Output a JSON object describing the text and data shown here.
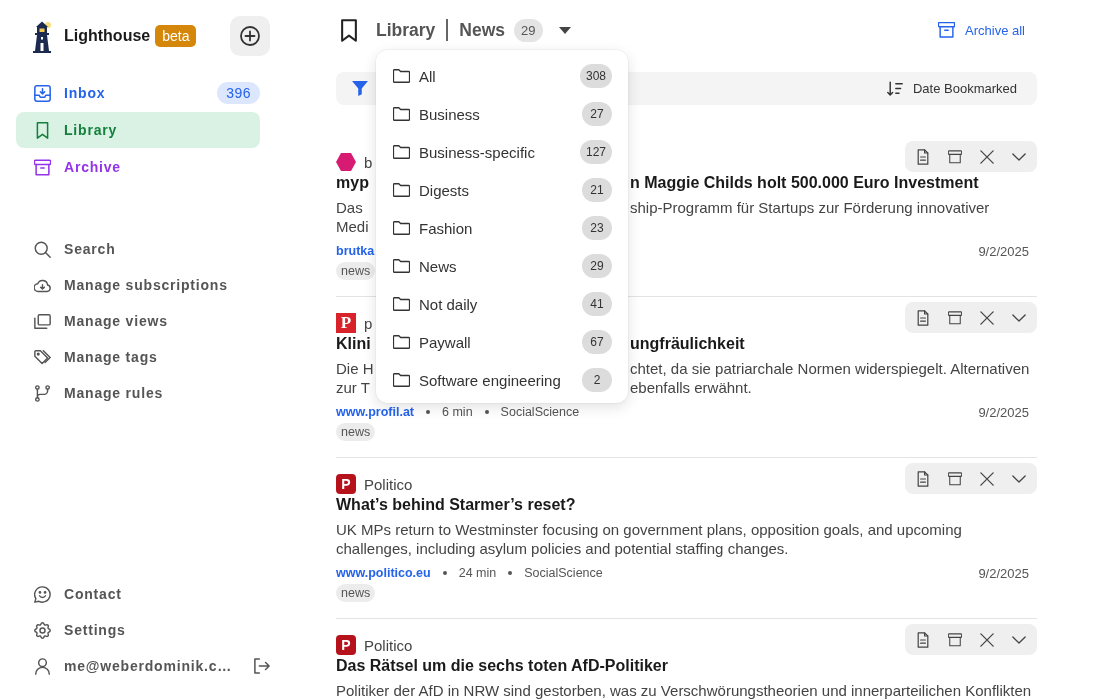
{
  "sidebar": {
    "brand": {
      "name": "Lighthouse",
      "badge": "beta"
    },
    "nav": [
      {
        "label": "Inbox",
        "color": "#2563eb",
        "selected": false,
        "count": "396"
      },
      {
        "label": "Library",
        "color": "#15803d",
        "selected": true
      },
      {
        "label": "Archive",
        "color": "#9333ea",
        "selected": false
      }
    ],
    "tools": [
      {
        "label": "Search"
      },
      {
        "label": "Manage subscriptions"
      },
      {
        "label": "Manage views"
      },
      {
        "label": "Manage tags"
      },
      {
        "label": "Manage rules"
      }
    ],
    "footer": [
      {
        "label": "Contact"
      },
      {
        "label": "Settings"
      }
    ],
    "user": {
      "email": "me@weberdominik.c…"
    }
  },
  "header": {
    "section": "Library",
    "view": "News",
    "count": "29",
    "archive_all": "Archive all"
  },
  "view_menu": [
    {
      "label": "All",
      "count": "308"
    },
    {
      "label": "Business",
      "count": "27"
    },
    {
      "label": "Business-specific",
      "count": "127"
    },
    {
      "label": "Digests",
      "count": "21"
    },
    {
      "label": "Fashion",
      "count": "23"
    },
    {
      "label": "News",
      "count": "29"
    },
    {
      "label": "Not daily",
      "count": "41"
    },
    {
      "label": "Paywall",
      "count": "67"
    },
    {
      "label": "Software engineering",
      "count": "2"
    }
  ],
  "toolbar": {
    "sort": "Date Bookmarked"
  },
  "articles": [
    {
      "logo": {
        "kind": "hexagon",
        "color": "#d81b72"
      },
      "source": "b",
      "title": [
        "myp",
        "n Maggie Childs holt 500.000 Euro Investment"
      ],
      "description": [
        [
          "Das",
          "ship-Programm für Startups zur Förderung innovativer"
        ],
        [
          "Medi"
        ]
      ],
      "site": "brutka",
      "date": "9/2/2025",
      "tags": [
        "news"
      ]
    },
    {
      "logo": {
        "kind": "serif-letter",
        "letter": "P",
        "color": "#d8232a"
      },
      "source": "p",
      "title": [
        "Klini",
        "ungfräulichkeit"
      ],
      "description": [
        [
          "Die H",
          "chtet, da sie patriarchale Normen widerspiegelt. Alternativen"
        ],
        [
          "zur T",
          "ebenfalls erwähnt."
        ]
      ],
      "site": "www.profil.at",
      "read_time": "6 min",
      "category": "SocialScience",
      "date": "9/2/2025",
      "tags": [
        "news"
      ]
    },
    {
      "logo": {
        "kind": "letter",
        "letter": "P",
        "color": "#b5121b"
      },
      "source": "Politico",
      "title": [
        "What’s behind Starmer’s reset?"
      ],
      "description": [
        [
          "UK MPs return to Westminster focusing on government plans, opposition goals, and upcoming"
        ],
        [
          "challenges, including asylum policies and potential staffing changes."
        ]
      ],
      "site": "www.politico.eu",
      "read_time": "24 min",
      "category": "SocialScience",
      "date": "9/2/2025",
      "tags": [
        "news"
      ]
    },
    {
      "logo": {
        "kind": "letter",
        "letter": "P",
        "color": "#b5121b"
      },
      "source": "Politico",
      "title": [
        "Das Rätsel um die sechs toten AfD-Politiker"
      ],
      "description": [
        [
          "Politiker der AfD in NRW sind gestorben, was zu Verschwörungstheorien und innerparteilichen Konflikten"
        ]
      ]
    }
  ]
}
